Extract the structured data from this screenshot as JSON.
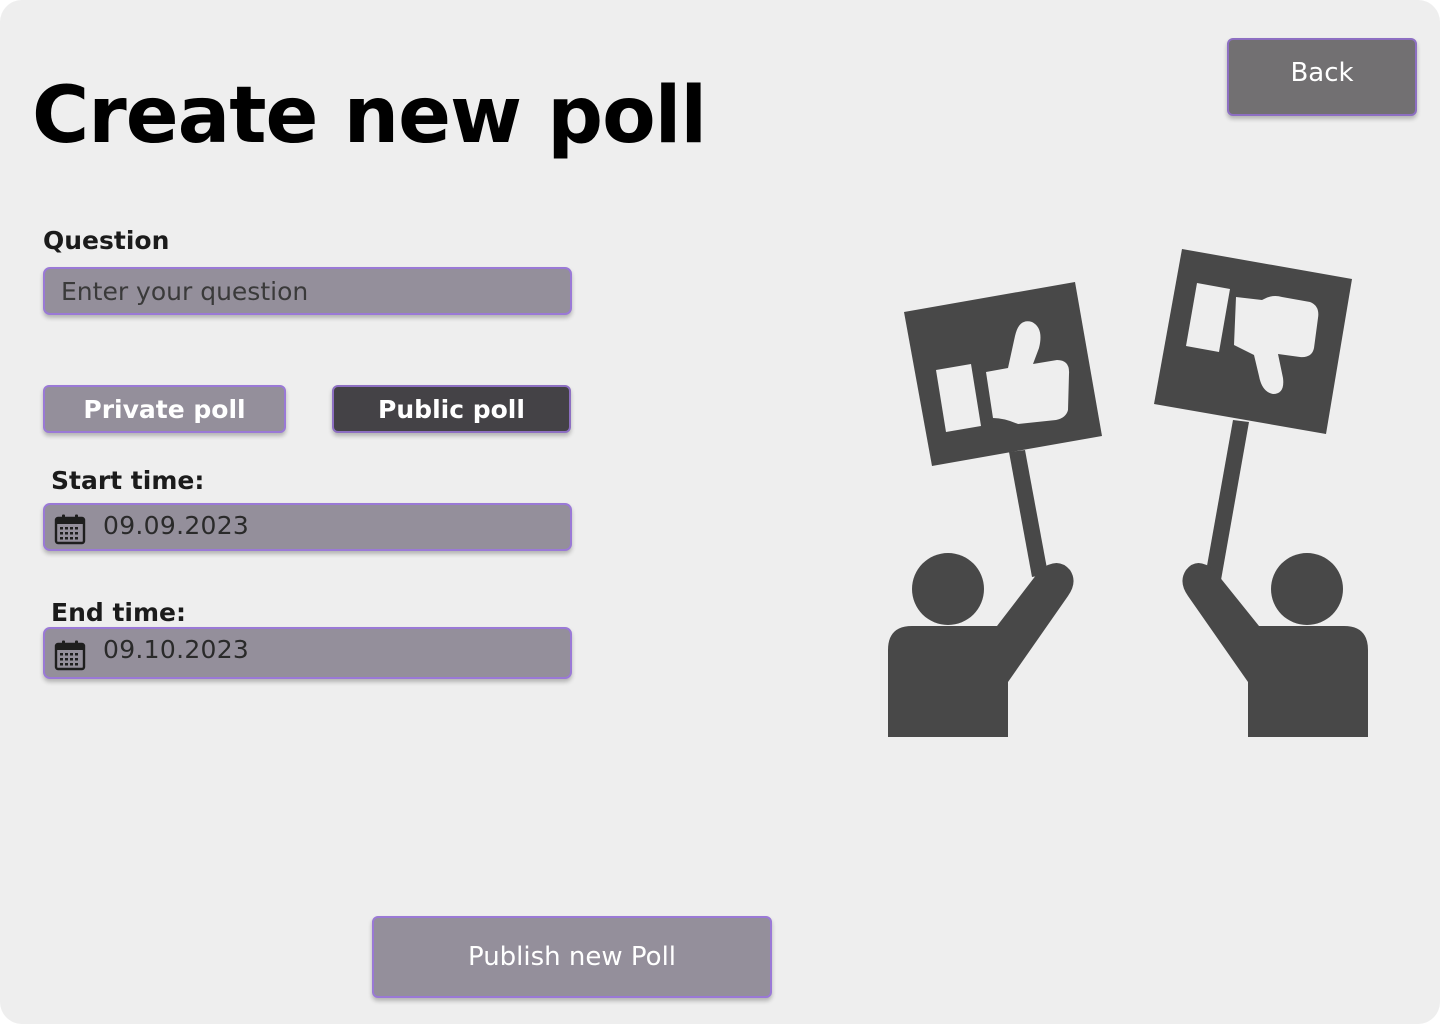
{
  "page": {
    "title": "Create new poll",
    "back_label": "Back"
  },
  "question": {
    "label": "Question",
    "placeholder": "Enter your question",
    "value": ""
  },
  "visibility": {
    "options": [
      {
        "label": "Private poll",
        "selected": false
      },
      {
        "label": "Public poll",
        "selected": true
      }
    ]
  },
  "start_time": {
    "label": "Start time:",
    "value": "09.09.2023",
    "icon": "calendar-icon"
  },
  "end_time": {
    "label": "End time:",
    "value": "09.10.2023",
    "icon": "calendar-icon"
  },
  "publish_label": "Publish new Poll",
  "illustration": {
    "icon": "voting-protesters-thumbs-up-down-illustration"
  },
  "colors": {
    "background": "#eeeeee",
    "field_fill": "#948f9b",
    "field_border": "#9a79d6",
    "selected_toggle": "#444246",
    "back_button": "#727072",
    "illustration": "#484848"
  }
}
